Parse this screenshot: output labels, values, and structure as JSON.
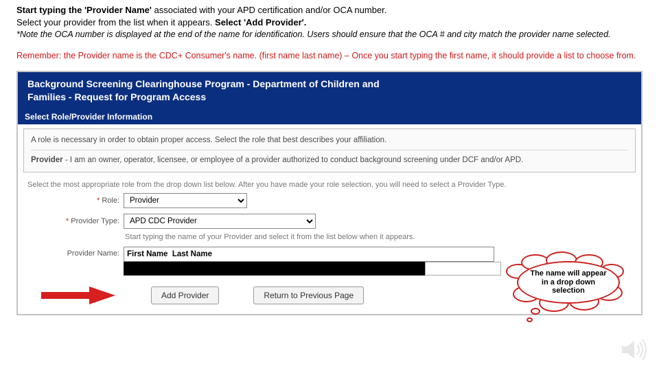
{
  "instructions": {
    "line1_a": "Start typing the 'Provider Name'",
    "line1_b": " associated with your APD certification and/or OCA number.",
    "line2_a": "Select your provider from the list when it appears. ",
    "line2_b": "Select 'Add Provider'."
  },
  "note": "*Note the OCA number is displayed at the end of the name for identification. Users should ensure that the OCA # and city match the provider name selected.",
  "remember": "Remember: the Provider name is the CDC+ Consumer's name. (first name last name) – Once you start typing the first name, it should provide a list to choose from.",
  "panel": {
    "title": "Background Screening Clearinghouse Program - Department of Children and Families - Request for Program Access",
    "right_text": "",
    "section": "Select Role/Provider Information",
    "info_line1": "A role is necessary in order to obtain proper access. Select the role that best describes your affiliation.",
    "info_line2_b": "Provider",
    "info_line2": " - I am an owner, operator, licensee, or employee of a provider authorized to conduct background screening under DCF and/or APD.",
    "body1": "Select the most appropriate role from the drop down list below. After you have made your role selection, you will need to select a Provider Type.",
    "role_label": "Role:",
    "role_value": "Provider",
    "ptype_label": "Provider Type:",
    "ptype_value": "APD CDC Provider",
    "hint": "Start typing the name of your Provider and select it from the list below when it appears.",
    "pname_label": "Provider Name:",
    "pname_value": "First Name  Last Name",
    "add_btn": "Add Provider",
    "return_btn": "Return to Previous Page"
  },
  "callout": "The name will appear in a drop down selection"
}
